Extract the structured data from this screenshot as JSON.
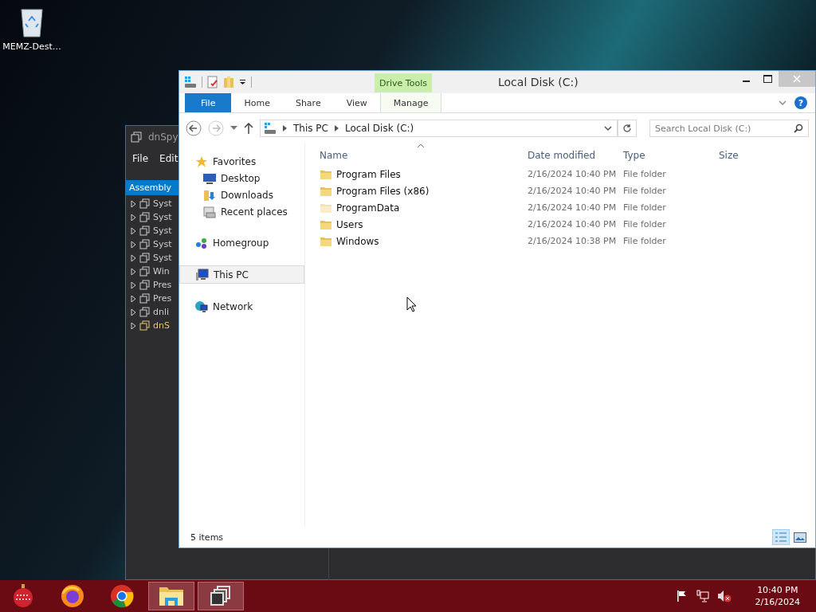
{
  "desktop": {
    "icons": [
      {
        "label": "MEMZ-Dest…"
      }
    ]
  },
  "background_window": {
    "title": "dnSpy",
    "menu": [
      "File",
      "Edit"
    ],
    "panel_tab": "Assembly",
    "tree": [
      {
        "label": "Syst",
        "selected": false
      },
      {
        "label": "Syst",
        "selected": false
      },
      {
        "label": "Syst",
        "selected": false
      },
      {
        "label": "Syst",
        "selected": false
      },
      {
        "label": "Syst",
        "selected": false
      },
      {
        "label": "Win",
        "selected": false
      },
      {
        "label": "Pres",
        "selected": false
      },
      {
        "label": "Pres",
        "selected": false
      },
      {
        "label": "dnli",
        "selected": false
      },
      {
        "label": "dnS",
        "selected": true
      }
    ]
  },
  "explorer": {
    "title": "Local Disk (C:)",
    "context_group": "Drive Tools",
    "ribbon_tabs": [
      {
        "label": "File",
        "kind": "file",
        "selected": false
      },
      {
        "label": "Home",
        "kind": "normal",
        "selected": false
      },
      {
        "label": "Share",
        "kind": "normal",
        "selected": false
      },
      {
        "label": "View",
        "kind": "normal",
        "selected": false
      },
      {
        "label": "Manage",
        "kind": "contextual",
        "selected": false
      }
    ],
    "help": "?",
    "breadcrumb": [
      "This PC",
      "Local Disk (C:)"
    ],
    "search": {
      "placeholder": "Search Local Disk (C:)"
    },
    "nav": [
      {
        "label": "Favorites",
        "kind": "star",
        "selected": false,
        "children": [
          {
            "label": "Desktop",
            "kind": "desktop",
            "selected": false
          },
          {
            "label": "Downloads",
            "kind": "downloads",
            "selected": false
          },
          {
            "label": "Recent places",
            "kind": "recent",
            "selected": false
          }
        ]
      },
      {
        "label": "Homegroup",
        "kind": "homegroup",
        "selected": false
      },
      {
        "label": "This PC",
        "kind": "pc",
        "selected": true
      },
      {
        "label": "Network",
        "kind": "network",
        "selected": false
      }
    ],
    "columns": [
      {
        "label": "Name",
        "sorted": true
      },
      {
        "label": "Date modified",
        "sorted": false
      },
      {
        "label": "Type",
        "sorted": false
      },
      {
        "label": "Size",
        "sorted": false
      }
    ],
    "rows": [
      {
        "name": "Program Files",
        "date": "2/16/2024 10:40 PM",
        "type": "File folder",
        "hidden": false
      },
      {
        "name": "Program Files (x86)",
        "date": "2/16/2024 10:40 PM",
        "type": "File folder",
        "hidden": false
      },
      {
        "name": "ProgramData",
        "date": "2/16/2024 10:40 PM",
        "type": "File folder",
        "hidden": true
      },
      {
        "name": "Users",
        "date": "2/16/2024 10:40 PM",
        "type": "File folder",
        "hidden": false
      },
      {
        "name": "Windows",
        "date": "2/16/2024 10:38 PM",
        "type": "File folder",
        "hidden": false
      }
    ],
    "status": "5 items",
    "views": [
      {
        "kind": "details",
        "selected": true
      },
      {
        "kind": "thumbnails",
        "selected": false
      }
    ]
  },
  "taskbar": {
    "apps": [
      {
        "kind": "ornament",
        "running": false
      },
      {
        "kind": "firefox",
        "running": false
      },
      {
        "kind": "chrome",
        "running": false
      },
      {
        "kind": "explorer",
        "running": true
      },
      {
        "kind": "windows",
        "running": true
      }
    ],
    "clock": {
      "time": "10:40 PM",
      "date": "2/16/2024"
    }
  }
}
